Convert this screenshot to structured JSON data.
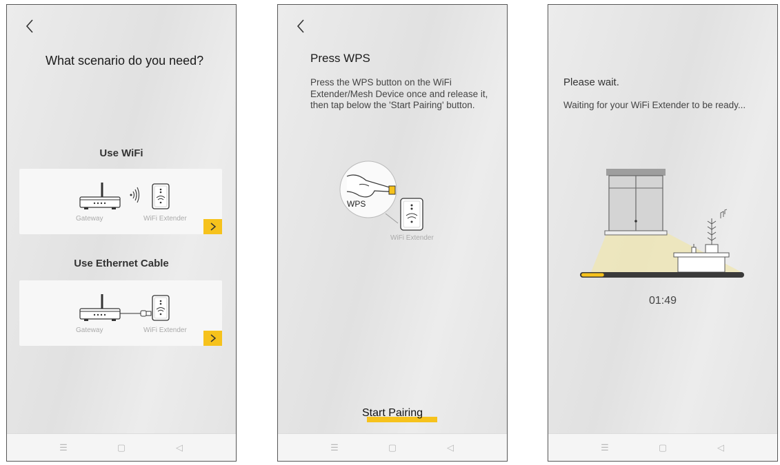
{
  "screen1": {
    "title": "What scenario do you need?",
    "option_wifi": {
      "label": "Use WiFi",
      "device_left": "Gateway",
      "device_right": "WiFi Extender"
    },
    "option_ethernet": {
      "label": "Use Ethernet Cable",
      "device_left": "Gateway",
      "device_right": "WiFi Extender"
    }
  },
  "screen2": {
    "title": "Press WPS",
    "instructions": "Press the WPS button on the WiFi Extender/Mesh Device once and release it, then tap below the 'Start Pairing' button.",
    "wps_label": "WPS",
    "device_label": "WiFi Extender",
    "start_button": "Start Pairing"
  },
  "screen3": {
    "title": "Please wait.",
    "message": "Waiting for your WiFi Extender to be ready...",
    "progress_fraction": 0.14,
    "timer": "01:49"
  },
  "icons": {
    "back": "chevron-left-icon",
    "next": "chevron-right-icon",
    "nav_menu": "menu-icon",
    "nav_home": "home-icon",
    "nav_back": "back-triangle-icon"
  },
  "colors": {
    "accent": "#f6c21c",
    "progress_track": "#3a3a3a"
  }
}
